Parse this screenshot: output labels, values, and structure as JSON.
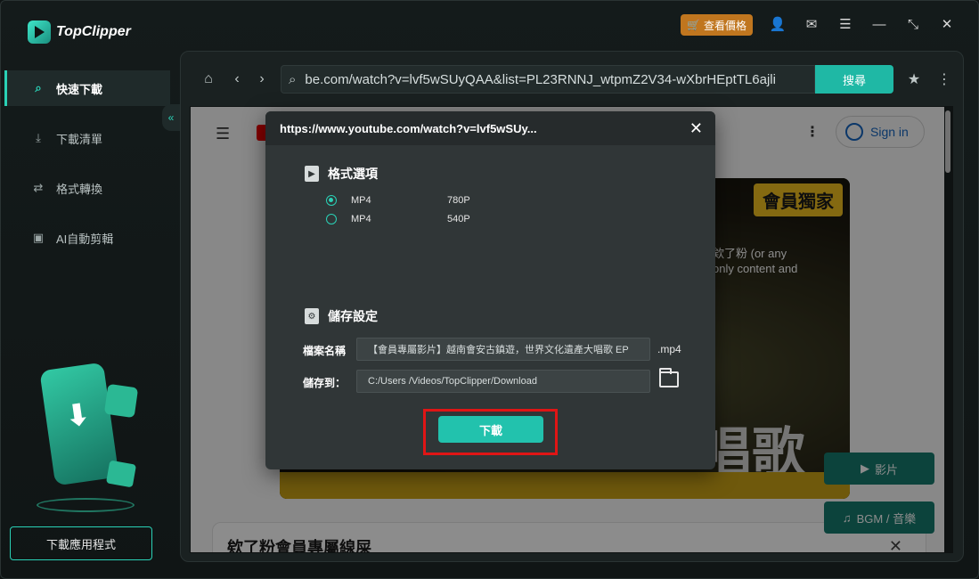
{
  "app": {
    "name": "TopClipper",
    "price_button": "查看價格"
  },
  "sidebar": {
    "items": [
      {
        "label": "快速下載",
        "icon": "search-icon"
      },
      {
        "label": "下載清單",
        "icon": "download-list-icon"
      },
      {
        "label": "格式轉換",
        "icon": "convert-icon"
      },
      {
        "label": "AI自動剪輯",
        "icon": "ai-edit-icon"
      }
    ],
    "download_app_button": "下載應用程式"
  },
  "browser": {
    "url": "be.com/watch?v=lvf5wSUyQAA&list=PL23RNNJ_wtpmZ2V34-wXbrHEptTL6ajli",
    "search_button": "搜尋"
  },
  "page": {
    "sign_in": "Sign in",
    "member_label": "會員獨家",
    "video_caption_line1": "欸了粉 (or any",
    "video_caption_line2": "only content and",
    "video_big_text": "唱歌",
    "section_title": "欸了粉會員專屬線屎"
  },
  "float_buttons": {
    "video": "影片",
    "bgm": "BGM / 音樂"
  },
  "dialog": {
    "title": "https://www.youtube.com/watch?v=lvf5wSUy...",
    "format_section_title": "格式選項",
    "options": [
      {
        "format": "MP4",
        "resolution": "780P",
        "selected": true
      },
      {
        "format": "MP4",
        "resolution": "540P",
        "selected": false
      }
    ],
    "save_section_title": "儲存設定",
    "filename_label": "檔案名稱",
    "filename_value": "【會員專屬影片】越南會安古鎮遊，世界文化遺產大唱歌 EP",
    "filename_ext": ".mp4",
    "save_to_label": "儲存到：",
    "save_to_value": "C:/Users              /Videos/TopClipper/Download",
    "download_button": "下載"
  },
  "colors": {
    "accent": "#22c2ad",
    "price_button": "#c0761f",
    "highlight_frame": "#e01515"
  }
}
